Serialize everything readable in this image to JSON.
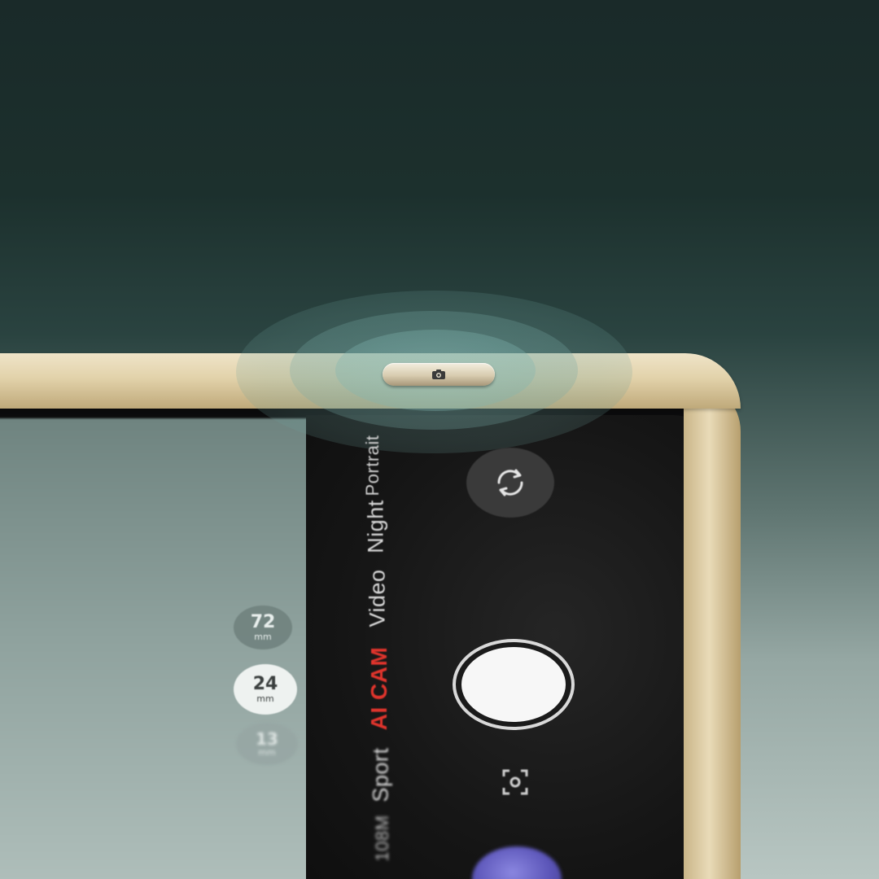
{
  "camera_ui": {
    "lenses": [
      {
        "value": "72",
        "unit": "mm"
      },
      {
        "value": "24",
        "unit": "mm"
      },
      {
        "value": "13",
        "unit": "mm"
      }
    ],
    "selected_lens": "24",
    "modes": [
      "Portrait",
      "Night",
      "Video",
      "AI CAM",
      "Sport",
      "108M"
    ],
    "selected_mode": "AI CAM"
  },
  "colors": {
    "frame_gold": "#e2d2aa",
    "active_mode": "#e0342c",
    "background_top": "#1a2a29",
    "background_bottom": "#b8c6c2"
  },
  "icons": {
    "side_button": "camera-icon",
    "switch": "switch-camera-icon",
    "scan": "scan-icon"
  }
}
